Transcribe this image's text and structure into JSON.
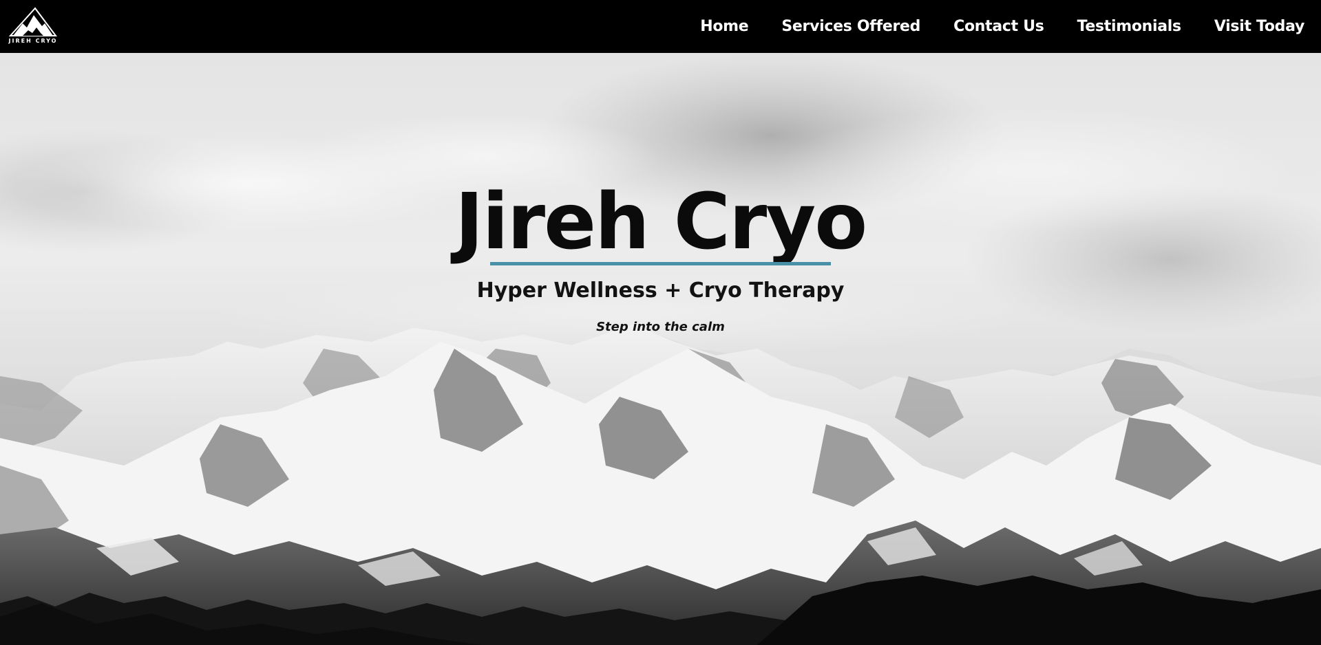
{
  "brand": {
    "logo_text": "JIREH CRYO",
    "logo_icon": "mountain-logo-icon"
  },
  "nav": {
    "items": [
      {
        "label": "Home"
      },
      {
        "label": "Services Offered"
      },
      {
        "label": "Contact Us"
      },
      {
        "label": "Testimonials"
      },
      {
        "label": "Visit Today"
      }
    ]
  },
  "hero": {
    "title": "Jireh Cryo",
    "subtitle": "Hyper Wellness + Cryo Therapy",
    "tagline": "Step into the calm",
    "background": "snowy-mountain-range-image"
  },
  "colors": {
    "nav_background": "#000000",
    "nav_text": "#ffffff",
    "accent_underline": "#4a8fa8",
    "hero_text": "#0b0b0b"
  }
}
